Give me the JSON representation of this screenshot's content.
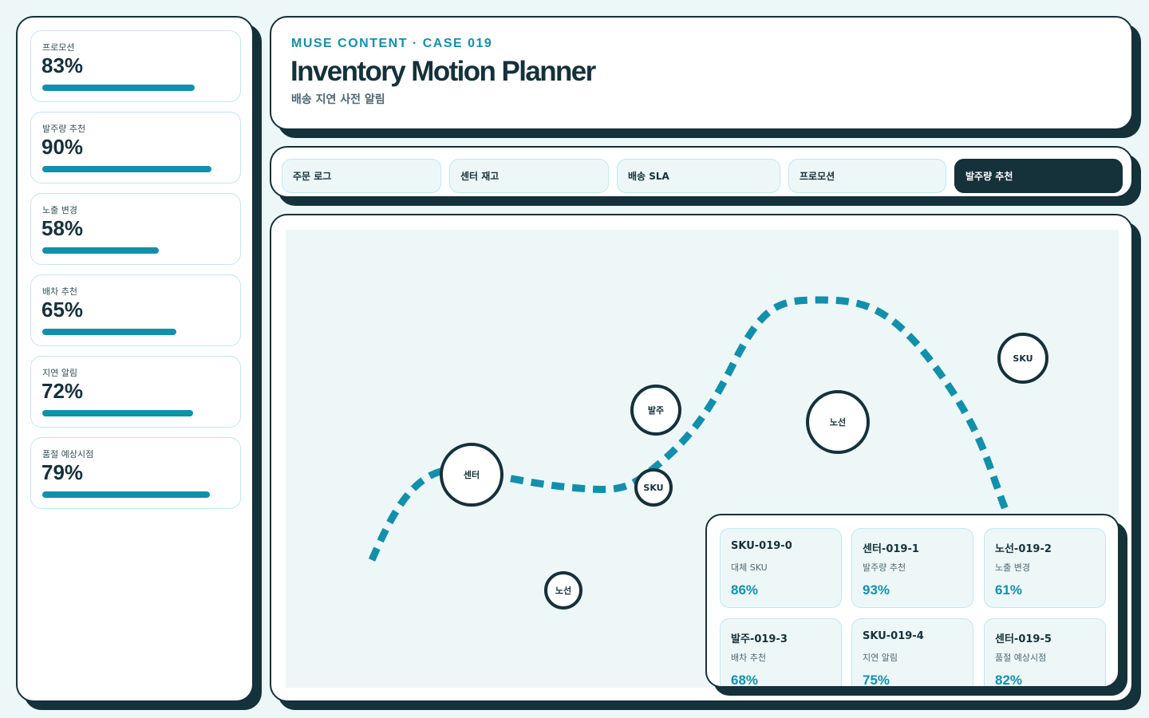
{
  "colors": {
    "ink": "#15313a",
    "accent": "#1190ac",
    "surface": "#eef7f8",
    "outline": "#bfe9ef"
  },
  "sidebar": {
    "metrics": [
      {
        "label": "프로모션",
        "value": "83%",
        "fill": 0.83
      },
      {
        "label": "발주량 추천",
        "value": "90%",
        "fill": 0.9
      },
      {
        "label": "노출 변경",
        "value": "58%",
        "fill": 0.58
      },
      {
        "label": "배차 추천",
        "value": "65%",
        "fill": 0.65
      },
      {
        "label": "지연 알림",
        "value": "72%",
        "fill": 0.72
      },
      {
        "label": "품절 예상시점",
        "value": "79%",
        "fill": 0.79
      }
    ]
  },
  "header": {
    "eyebrow": "MUSE CONTENT · CASE 019",
    "title": "Inventory Motion Planner",
    "subtitle": "배송 지연 사전 알림"
  },
  "tabs": [
    {
      "label": "주문 로그",
      "active": false
    },
    {
      "label": "센터 재고",
      "active": false
    },
    {
      "label": "배송 SLA",
      "active": false
    },
    {
      "label": "프로모션",
      "active": false
    },
    {
      "label": "발주량 추천",
      "active": true
    }
  ],
  "stage": {
    "nodes": [
      {
        "label": "센터"
      },
      {
        "label": "발주"
      },
      {
        "label": "SKU"
      },
      {
        "label": "노선"
      },
      {
        "label": "SKU"
      },
      {
        "label": "노선"
      }
    ]
  },
  "sku_cards": [
    {
      "code": "SKU-019-0",
      "note": "대체 SKU",
      "value": "86%"
    },
    {
      "code": "센터-019-1",
      "note": "발주량 추천",
      "value": "93%"
    },
    {
      "code": "노선-019-2",
      "note": "노출 변경",
      "value": "61%"
    },
    {
      "code": "발주-019-3",
      "note": "배차 추천",
      "value": "68%"
    },
    {
      "code": "SKU-019-4",
      "note": "지연 알림",
      "value": "75%"
    },
    {
      "code": "센터-019-5",
      "note": "품절 예상시점",
      "value": "82%"
    }
  ]
}
